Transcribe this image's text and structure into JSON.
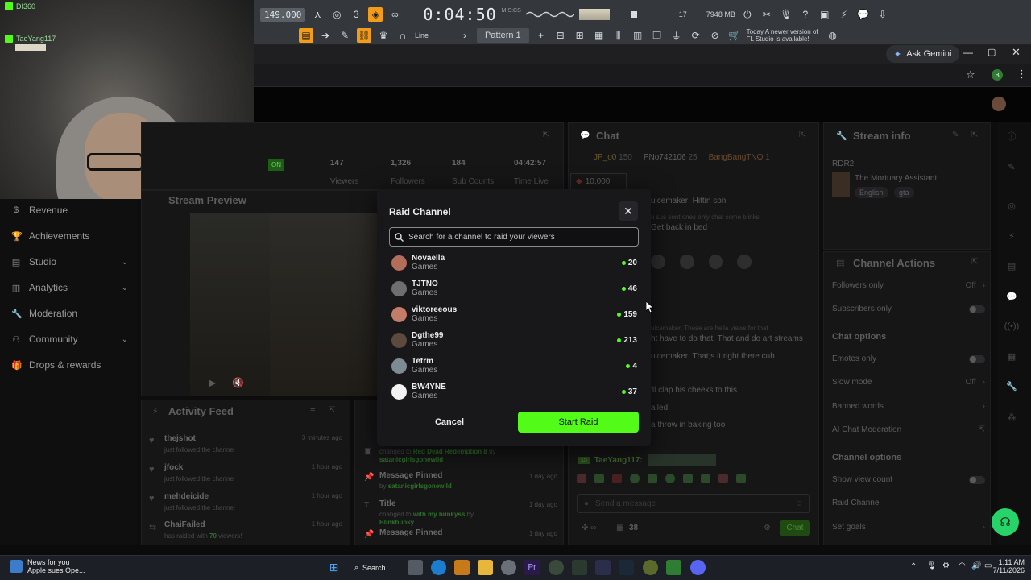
{
  "fl": {
    "bpm": "149.000",
    "time": "0:04:50",
    "time_label": "M:S:CS",
    "cpu_num": "17",
    "mem": "7948 MB",
    "mem_sub": "4",
    "snap": "Line",
    "pattern": "Pattern 1",
    "hint_day": "Today",
    "hint_text": "A newer version of FL Studio is available!"
  },
  "chrome": {
    "ask_gemini": "Ask Gemini",
    "profile": "B"
  },
  "webcam": {
    "user1": "DI360",
    "user2": "TaeYang117"
  },
  "sidebar": {
    "items": [
      {
        "label": "Revenue",
        "icon": "dollar-icon",
        "chev": false
      },
      {
        "label": "Achievements",
        "icon": "trophy-icon",
        "chev": false
      },
      {
        "label": "Studio",
        "icon": "studio-icon",
        "chev": true
      },
      {
        "label": "Analytics",
        "icon": "analytics-icon",
        "chev": true
      },
      {
        "label": "Moderation",
        "icon": "wrench-icon",
        "chev": false
      },
      {
        "label": "Community",
        "icon": "community-icon",
        "chev": true
      },
      {
        "label": "Drops & rewards",
        "icon": "gift-icon",
        "chev": false
      }
    ]
  },
  "stats": {
    "live_badge": "ON",
    "viewers_num": "147",
    "viewers_lbl": "Viewers",
    "followers_num": "1,326",
    "followers_lbl": "Followers",
    "subs_num": "184",
    "subs_lbl": "Sub Counts",
    "time_num": "04:42:57",
    "time_lbl": "Time Live"
  },
  "preview_title": "Stream Preview",
  "activity": {
    "title": "Activity Feed",
    "rows": [
      {
        "name": "thejshot",
        "desc": "just followed the channel",
        "when": "3 minutes ago"
      },
      {
        "name": "jfock",
        "desc": "just followed the channel",
        "when": "1 hour ago"
      },
      {
        "name": "mehdeicide",
        "desc": "just followed the channel",
        "when": "1 hour ago"
      },
      {
        "name": "ChaiFailed",
        "desc_a": "has raided with",
        "desc_b": "70",
        "desc_c": "viewers!",
        "when": "1 hour ago"
      }
    ]
  },
  "mod_log": {
    "rows": [
      {
        "name": "",
        "desc_a": "changed to",
        "desc_b": "Red Dead Redemption 8",
        "desc_c": "by",
        "by": "satanicgirlsgonewild",
        "when": ""
      },
      {
        "name": "Message Pinned",
        "desc_a": "by",
        "by": "satanicgirlsgonewild",
        "when": "1 day ago"
      },
      {
        "name": "Title",
        "desc_a": "changed to",
        "desc_b": "with my bunkyss",
        "desc_c": "by",
        "by": "Blinkbunky",
        "when": "1 day ago"
      },
      {
        "name": "Message Pinned",
        "when": "1 day ago"
      }
    ]
  },
  "chat": {
    "title": "Chat",
    "top_users": [
      "JP_o0",
      "PNo742106",
      "BangBangTNO"
    ],
    "top_user_counts": [
      "150",
      "25",
      "1"
    ],
    "goal": "10,000",
    "lines": [
      "uicemaker: Hittin son",
      "u sus sont ones only chat come blinks",
      "Get back in bed",
      "uicemaker: These are hella views for that",
      "ht have to do that. That and do art streams",
      "uicemaker: That;s it right there cuh",
      "'ll clap his cheeks to this",
      "ailed:",
      "a throw in baking too"
    ],
    "last_user": "TaeYang117:",
    "input_placeholder": "Send a message",
    "send_label": "Chat",
    "viewer_count": "38"
  },
  "stream_info": {
    "title": "Stream info",
    "category": "RDR2",
    "game": "The Mortuary Assistant",
    "tags": [
      "English",
      "gta"
    ]
  },
  "channel_actions": {
    "title": "Channel Actions",
    "rows": [
      {
        "label": "Followers only",
        "right": "Off",
        "type": "chev"
      },
      {
        "label": "Subscribers only",
        "type": "toggle"
      },
      {
        "label": "Chat options",
        "type": "head"
      },
      {
        "label": "Emotes only",
        "type": "toggle"
      },
      {
        "label": "Slow mode",
        "right": "Off",
        "type": "chev"
      },
      {
        "label": "Banned words",
        "type": "chev"
      },
      {
        "label": "AI Chat Moderation",
        "type": "ext"
      },
      {
        "label": "Channel options",
        "type": "head"
      },
      {
        "label": "Show view count",
        "type": "toggle"
      },
      {
        "label": "Raid Channel",
        "type": "none"
      },
      {
        "label": "Set goals",
        "type": "chev"
      }
    ]
  },
  "modal": {
    "title": "Raid Channel",
    "search_placeholder": "Search for a channel to raid your viewers",
    "channels": [
      {
        "name": "Novaella",
        "category": "Games",
        "count": "20",
        "color": "#b46d5a"
      },
      {
        "name": "TJTNO",
        "category": "Games",
        "count": "46",
        "color": "#6e6e72"
      },
      {
        "name": "viktoreeous",
        "category": "Games",
        "count": "159",
        "color": "#c27c68"
      },
      {
        "name": "Dgthe99",
        "category": "Games",
        "count": "213",
        "color": "#5b4a3d"
      },
      {
        "name": "Tetrm",
        "category": "Games",
        "count": "4",
        "color": "#7d8c94"
      },
      {
        "name": "BW4YNE",
        "category": "Games",
        "count": "37",
        "color": "#f2f2f2"
      }
    ],
    "cancel": "Cancel",
    "confirm": "Start Raid"
  },
  "taskbar": {
    "news_title": "News for you",
    "news_sub": "Apple sues Ope...",
    "search": "Search",
    "time": "1:11 AM",
    "date": "7/11/2026"
  },
  "colors": {
    "kick_green": "#53fc18",
    "fl_orange": "#f29c1b"
  }
}
